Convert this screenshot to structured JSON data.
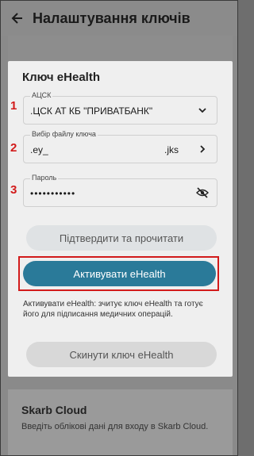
{
  "appbar": {
    "title": "Налаштування ключів",
    "back_icon": "arrow-left-icon"
  },
  "ehealth": {
    "section_title": "Ключ eHealth",
    "fields": [
      {
        "marker": "1",
        "label": "АЦСК",
        "value": ".ЦСК АТ КБ \"ПРИВАТБАНК\"",
        "icon": "chevron-down-icon"
      },
      {
        "marker": "2",
        "label": "Вибір файлу ключа",
        "value": ".ey_",
        "suffix": ".jks",
        "icon": "chevron-right-icon"
      },
      {
        "marker": "3",
        "label": "Пароль",
        "value": "•••••••••••",
        "icon": "eye-off-icon"
      }
    ],
    "confirm_button": "Підтвердити та прочитати",
    "activate_button": "Активувати eHealth",
    "description": "Активувати eHealth: зчитує ключ eHealth та готує його для підписання медичних операцій.",
    "reset_button": "Скинути ключ eHealth"
  },
  "skarb": {
    "title": "Skarb Cloud",
    "description": "Введіть облікові дані для входу в Skarb Cloud."
  },
  "colors": {
    "accent": "#2a7a99",
    "highlight": "#d21a1a"
  }
}
